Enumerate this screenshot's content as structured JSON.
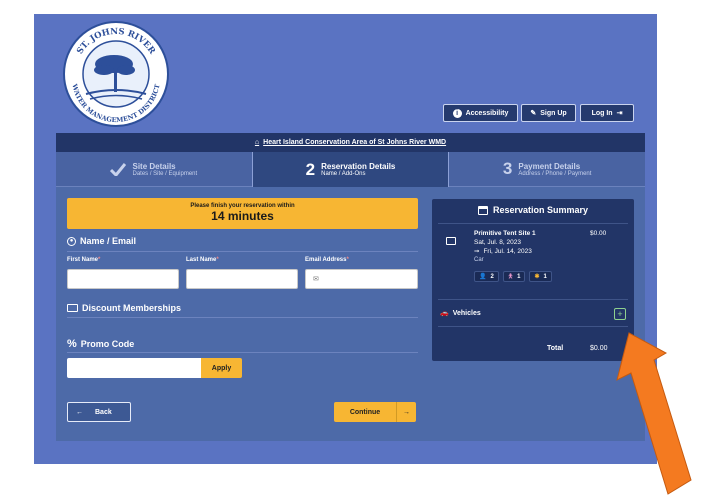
{
  "logo": {
    "top_text": "ST. JOHNS RIVER",
    "bottom_text": "WATER MANAGEMENT DISTRICT"
  },
  "header_buttons": {
    "accessibility": "Accessibility",
    "sign_up": "Sign Up",
    "log_in": "Log In"
  },
  "breadcrumb": "Heart Island Conservation Area of St Johns River WMD",
  "steps": [
    {
      "number": "",
      "title": "Site Details",
      "subtitle": "Dates / Site / Equipment"
    },
    {
      "number": "2",
      "title": "Reservation Details",
      "subtitle": "Name / Add-Ons"
    },
    {
      "number": "3",
      "title": "Payment Details",
      "subtitle": "Address / Phone / Payment"
    }
  ],
  "timer": {
    "line1": "Please finish your reservation within",
    "line2": "14 minutes"
  },
  "name_email": {
    "title": "Name / Email",
    "first_name_label": "First Name",
    "last_name_label": "Last Name",
    "email_label": "Email Address",
    "required_mark": "*"
  },
  "discount": {
    "title": "Discount Memberships"
  },
  "promo": {
    "title": "Promo Code",
    "apply_label": "Apply"
  },
  "nav": {
    "back_label": "Back",
    "continue_label": "Continue"
  },
  "summary": {
    "title": "Reservation Summary",
    "item_name": "Primitive Tent Site 1",
    "date_start": "Sat, Jul. 8, 2023",
    "date_end": "Fri, Jul. 14, 2023",
    "vehicle_type": "Car",
    "price": "$0.00",
    "badges": [
      "2",
      "1",
      "1"
    ],
    "vehicles_label": "Vehicles",
    "plus": "+",
    "total_label": "Total",
    "total_value": "$0.00"
  },
  "colors": {
    "accent": "#f7b633",
    "navy": "#223567",
    "frame": "#5a73c2",
    "arrow": "#f47a20"
  }
}
